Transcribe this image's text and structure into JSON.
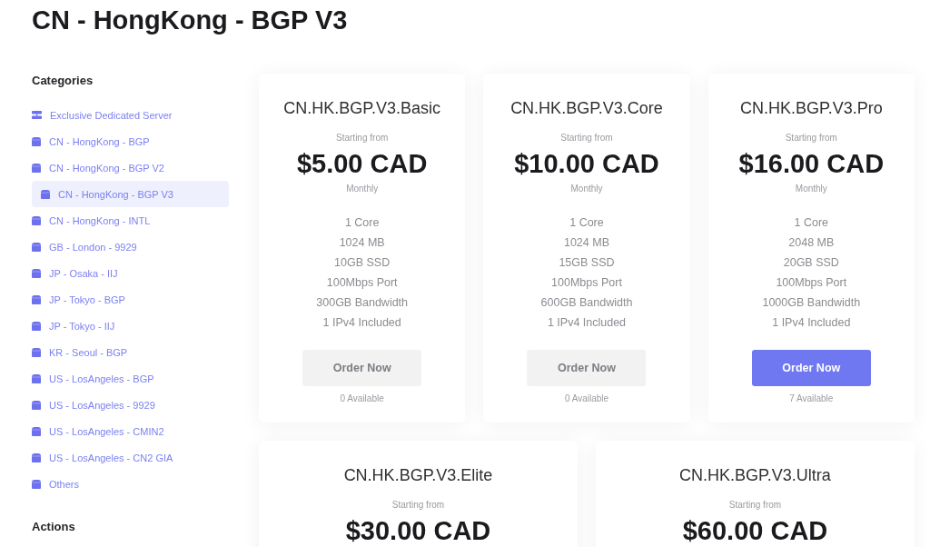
{
  "page": {
    "title": "CN - HongKong - BGP V3"
  },
  "sidebar": {
    "categories_heading": "Categories",
    "categories": [
      {
        "label": "Exclusive Dedicated Server",
        "kind": "server",
        "selected": false
      },
      {
        "label": "CN - HongKong - BGP",
        "kind": "box",
        "selected": false
      },
      {
        "label": "CN - HongKong - BGP V2",
        "kind": "box",
        "selected": false
      },
      {
        "label": "CN - HongKong - BGP V3",
        "kind": "box",
        "selected": true
      },
      {
        "label": "CN - HongKong - INTL",
        "kind": "box",
        "selected": false
      },
      {
        "label": "GB - London - 9929",
        "kind": "box",
        "selected": false
      },
      {
        "label": "JP - Osaka - IIJ",
        "kind": "box",
        "selected": false
      },
      {
        "label": "JP - Tokyo - BGP",
        "kind": "box",
        "selected": false
      },
      {
        "label": "JP - Tokyo - IIJ",
        "kind": "box",
        "selected": false
      },
      {
        "label": "KR - Seoul - BGP",
        "kind": "box",
        "selected": false
      },
      {
        "label": "US - LosAngeles - BGP",
        "kind": "box",
        "selected": false
      },
      {
        "label": "US - LosAngeles - 9929",
        "kind": "box",
        "selected": false
      },
      {
        "label": "US - LosAngeles - CMIN2",
        "kind": "box",
        "selected": false
      },
      {
        "label": "US - LosAngeles - CN2 GIA",
        "kind": "box",
        "selected": false
      },
      {
        "label": "Others",
        "kind": "box",
        "selected": false
      }
    ],
    "actions_heading": "Actions"
  },
  "plans": [
    {
      "name": "CN.HK.BGP.V3.Basic",
      "starting_label": "Starting from",
      "price": "$5.00 CAD",
      "cycle": "Monthly",
      "features": [
        "1 Core",
        "1024 MB",
        "10GB SSD",
        "100Mbps Port",
        "300GB Bandwidth",
        "1 IPv4 Included"
      ],
      "button": {
        "label": "Order Now",
        "disabled": true
      },
      "availability": "0 Available"
    },
    {
      "name": "CN.HK.BGP.V3.Core",
      "starting_label": "Starting from",
      "price": "$10.00 CAD",
      "cycle": "Monthly",
      "features": [
        "1 Core",
        "1024 MB",
        "15GB SSD",
        "100Mbps Port",
        "600GB Bandwidth",
        "1 IPv4 Included"
      ],
      "button": {
        "label": "Order Now",
        "disabled": true
      },
      "availability": "0 Available"
    },
    {
      "name": "CN.HK.BGP.V3.Pro",
      "starting_label": "Starting from",
      "price": "$16.00 CAD",
      "cycle": "Monthly",
      "features": [
        "1 Core",
        "2048 MB",
        "20GB SSD",
        "100Mbps Port",
        "1000GB Bandwidth",
        "1 IPv4 Included"
      ],
      "button": {
        "label": "Order Now",
        "disabled": false
      },
      "availability": "7 Available"
    },
    {
      "name": "CN.HK.BGP.V3.Elite",
      "starting_label": "Starting from",
      "price": "$30.00 CAD"
    },
    {
      "name": "CN.HK.BGP.V3.Ultra",
      "starting_label": "Starting from",
      "price": "$60.00 CAD"
    }
  ]
}
